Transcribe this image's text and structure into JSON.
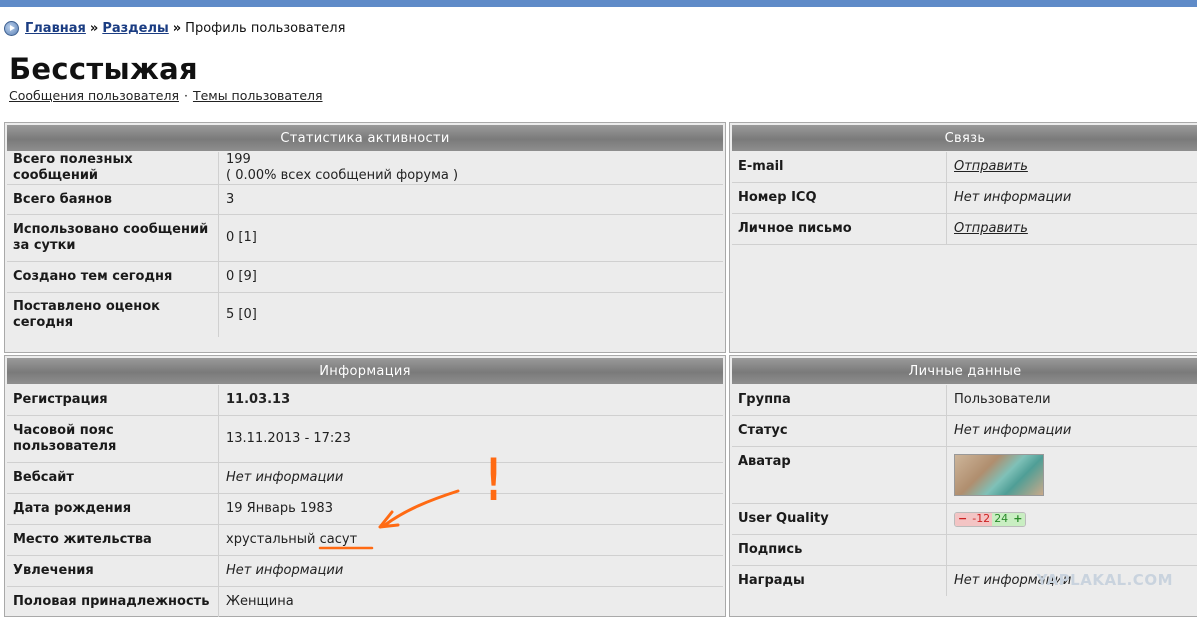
{
  "breadcrumb": {
    "home": "Главная",
    "sep1": "»",
    "sections": "Разделы",
    "sep2": "»",
    "current": "Профиль пользователя"
  },
  "profile": {
    "name": "Бесстыжая",
    "link_messages": "Сообщения пользователя",
    "link_dot": "·",
    "link_topics": "Темы пользователя"
  },
  "activity": {
    "header": "Статистика активности",
    "rows": [
      {
        "label": "Всего полезных сообщений",
        "value": "199",
        "value2": "( 0.00% всех сообщений форума )"
      },
      {
        "label": "Всего баянов",
        "value": "3"
      },
      {
        "label": "Использовано сообщений за сутки",
        "value": "0 [1]"
      },
      {
        "label": "Создано тем сегодня",
        "value": "0 [9]"
      },
      {
        "label": "Поставлено оценок сегодня",
        "value": "5 [0]"
      }
    ]
  },
  "contact": {
    "header": "Связь",
    "rows": [
      {
        "label": "E-mail",
        "value": "Отправить"
      },
      {
        "label": "Номер ICQ",
        "value": "Нет информации"
      },
      {
        "label": "Личное письмо",
        "value": "Отправить"
      }
    ]
  },
  "info": {
    "header": "Информация",
    "rows": [
      {
        "label": "Регистрация",
        "value": "11.03.13"
      },
      {
        "label": "Часовой пояс пользователя",
        "value": "13.11.2013 - 17:23"
      },
      {
        "label": "Вебсайт",
        "value": "Нет информации"
      },
      {
        "label": "Дата рождения",
        "value": "19 Январь 1983"
      },
      {
        "label": "Место жительства",
        "value": "хрустальный сасут"
      },
      {
        "label": "Увлечения",
        "value": "Нет информации"
      },
      {
        "label": "Половая принадлежность",
        "value": "Женщина"
      }
    ]
  },
  "personal": {
    "header": "Личные данные",
    "rows": [
      {
        "label": "Группа",
        "value": "Пользователи"
      },
      {
        "label": "Статус",
        "value": "Нет информации"
      },
      {
        "label": "Аватар"
      },
      {
        "label": "User Quality",
        "minus": "−",
        "value_red": "-12",
        "value_green": "24",
        "plus": "+"
      },
      {
        "label": "Подпись",
        "value": ""
      },
      {
        "label": "Награды",
        "value": "Нет информации"
      }
    ]
  },
  "watermark": "YAPLAKAL.COM",
  "annotation": {
    "mark": "!"
  }
}
